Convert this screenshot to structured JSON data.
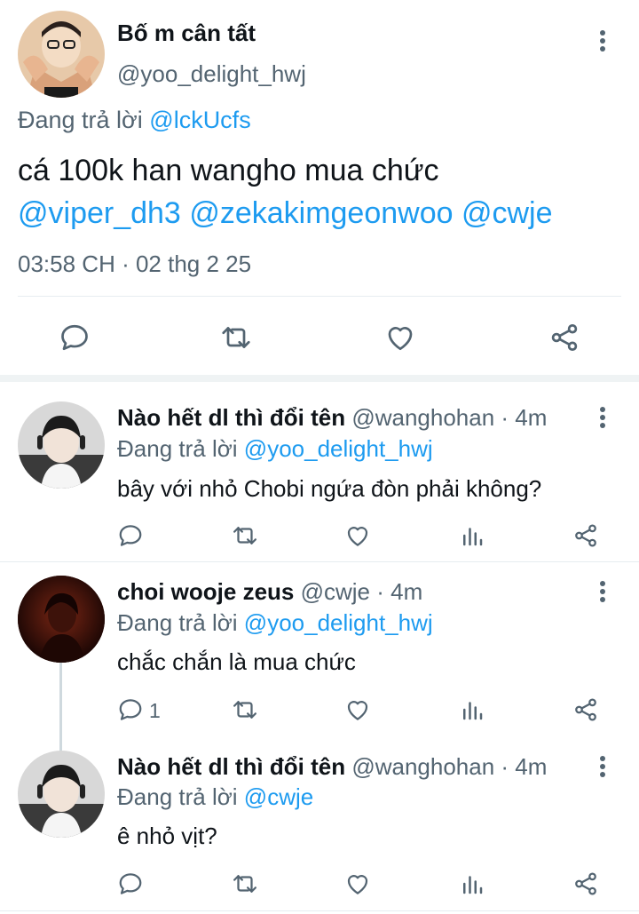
{
  "main_tweet": {
    "display_name": "Bố m cân tất",
    "handle": "@yoo_delight_hwj",
    "replying_prefix": "Đang trả lời",
    "replying_to": "@lckUcfs",
    "text_line1": "cá 100k han wangho mua chức",
    "mentions": [
      "@viper_dh3",
      "@zekakimgeonwoo",
      "@cwje"
    ],
    "timestamp": "03:58 CH · 02 thg 2 25",
    "actions": [
      "reply-icon",
      "retweet-icon",
      "like-icon",
      "share-icon"
    ]
  },
  "replies": [
    {
      "display_name": "Nào hết dl thì đổi tên",
      "handle": "@wanghohan",
      "time": "· 4m",
      "replying_prefix": "Đang trả lời",
      "replying_to": "@yoo_delight_hwj",
      "text": "bây với nhỏ Chobi ngứa đòn phải không?",
      "reply_count": ""
    },
    {
      "display_name": "choi wooje zeus",
      "handle": "@cwje",
      "time": "· 4m",
      "replying_prefix": "Đang trả lời",
      "replying_to": "@yoo_delight_hwj",
      "text": "chắc chắn là mua chức",
      "reply_count": "1"
    },
    {
      "display_name": "Nào hết dl thì đổi tên",
      "handle": "@wanghohan",
      "time": "· 4m",
      "replying_prefix": "Đang trả lời",
      "replying_to": "@cwje",
      "text": "ê nhỏ vịt?",
      "reply_count": ""
    }
  ],
  "colors": {
    "accent": "#1d9bf0",
    "text": "#0f1419",
    "secondary": "#536471",
    "divider": "#e6ecf0"
  }
}
